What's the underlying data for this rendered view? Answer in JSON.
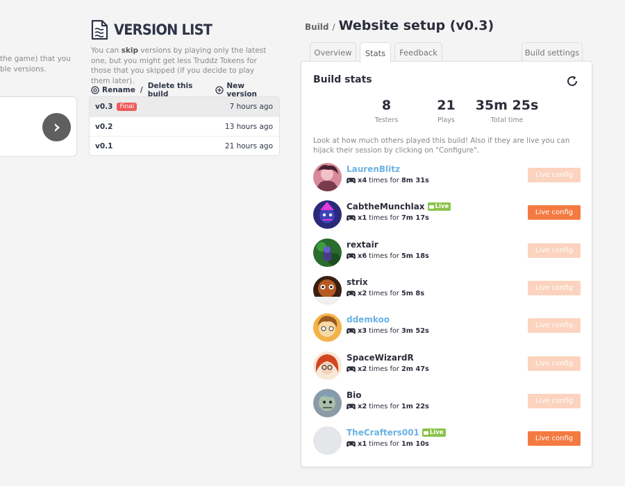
{
  "left_panel": {
    "desc_line1": "the game) that you",
    "desc_line2": "ble versions."
  },
  "version_list": {
    "title": "VERSION LIST",
    "desc_pre": "You can ",
    "desc_bold": "skip",
    "desc_post": " versions by playing only the latest one, but you might get less Truddz Tokens for those that you skipped (if you decide to play them later).",
    "rename_label": "Rename",
    "separator": "/",
    "delete_label": "Delete this build",
    "new_version_label": "New version",
    "versions": [
      {
        "name": "v0.3",
        "tag": "Final",
        "time": "7 hours ago"
      },
      {
        "name": "v0.2",
        "tag": "",
        "time": "13 hours ago"
      },
      {
        "name": "v0.1",
        "tag": "",
        "time": "21 hours ago"
      }
    ]
  },
  "build": {
    "breadcrumb": "Build",
    "slash": "/",
    "title": "Website setup (v0.3)",
    "tabs": {
      "overview": "Overview",
      "stats": "Stats",
      "feedback": "Feedback",
      "settings": "Build settings"
    },
    "active_tab": "Stats"
  },
  "stats": {
    "title": "Build stats",
    "testers": {
      "value": "8",
      "label": "Testers"
    },
    "plays": {
      "value": "21",
      "label": "Plays"
    },
    "total_time": {
      "value": "35m 25s",
      "label": "Total time"
    },
    "description": "Look at how much others played this build! Also if they are live you can hijack their session by clicking on \"Configure\".",
    "config_label": "Live config",
    "live_label": "Live",
    "times_for": "times for",
    "players": [
      {
        "name": "LaurenBlitz",
        "count": "x4",
        "time": "8m 31s",
        "live": false,
        "link": true
      },
      {
        "name": "CabtheMunchlax",
        "count": "x1",
        "time": "7m 17s",
        "live": true,
        "link": false
      },
      {
        "name": "rextair",
        "count": "x6",
        "time": "5m 18s",
        "live": false,
        "link": false
      },
      {
        "name": "strix",
        "count": "x2",
        "time": "5m 8s",
        "live": false,
        "link": false
      },
      {
        "name": "ddemkoo",
        "count": "x3",
        "time": "3m 52s",
        "live": false,
        "link": true
      },
      {
        "name": "SpaceWizardR",
        "count": "x2",
        "time": "2m 47s",
        "live": false,
        "link": false
      },
      {
        "name": "Bio",
        "count": "x2",
        "time": "1m 22s",
        "live": false,
        "link": false
      },
      {
        "name": "TheCrafters001",
        "count": "x1",
        "time": "1m 10s",
        "live": true,
        "link": true
      }
    ]
  },
  "colors": {
    "accent_orange": "#f47a42",
    "accent_orange_disabled": "#fbd3be",
    "live_green": "#8bc34a",
    "link_blue": "#6ab2e2",
    "final_tag_red": "#ee5a5a"
  }
}
